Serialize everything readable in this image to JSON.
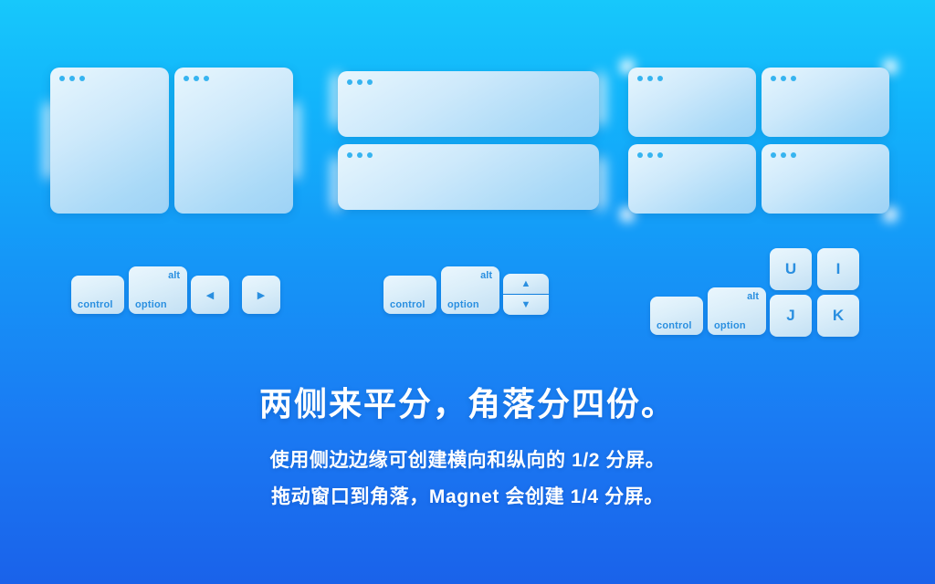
{
  "background": {
    "gradient_top": "#17c8fb",
    "gradient_bottom": "#1a62ea"
  },
  "colors": {
    "key_text": "#2a8fe0",
    "window_fill": "#bfe3f9",
    "dot": "#36b4f0",
    "text": "#ffffff"
  },
  "illustration": {
    "groups": [
      {
        "name": "vertical-halves",
        "description": "two side-by-side half windows",
        "windows": [
          "left-half",
          "right-half"
        ]
      },
      {
        "name": "horizontal-halves",
        "description": "two stacked half windows",
        "windows": [
          "top-half",
          "bottom-half"
        ]
      },
      {
        "name": "quarters",
        "description": "four quarter windows",
        "windows": [
          "top-left-quarter",
          "top-right-quarter",
          "bottom-left-quarter",
          "bottom-right-quarter"
        ]
      }
    ]
  },
  "shortcuts": [
    {
      "name": "vertical-halves-shortcut",
      "keys": [
        {
          "id": "control",
          "main": "control",
          "alt": ""
        },
        {
          "id": "option",
          "main": "option",
          "alt": "alt"
        },
        {
          "id": "arrow-left",
          "glyph": "◀"
        },
        {
          "id": "arrow-right",
          "glyph": "▶"
        }
      ]
    },
    {
      "name": "horizontal-halves-shortcut",
      "keys": [
        {
          "id": "control",
          "main": "control",
          "alt": ""
        },
        {
          "id": "option",
          "main": "option",
          "alt": "alt"
        },
        {
          "id": "arrow-up",
          "glyph": "▲"
        },
        {
          "id": "arrow-down",
          "glyph": "▼"
        }
      ]
    },
    {
      "name": "quarters-shortcut",
      "keys": [
        {
          "id": "control",
          "main": "control",
          "alt": ""
        },
        {
          "id": "option",
          "main": "option",
          "alt": "alt"
        },
        {
          "id": "u",
          "glyph": "U"
        },
        {
          "id": "i",
          "glyph": "I"
        },
        {
          "id": "j",
          "glyph": "J"
        },
        {
          "id": "k",
          "glyph": "K"
        }
      ]
    }
  ],
  "copy": {
    "headline": "两侧来平分，角落分四份。",
    "line1": "使用侧边边缘可创建横向和纵向的 1/2 分屏。",
    "line2": "拖动窗口到角落，Magnet 会创建 1/4 分屏。"
  }
}
